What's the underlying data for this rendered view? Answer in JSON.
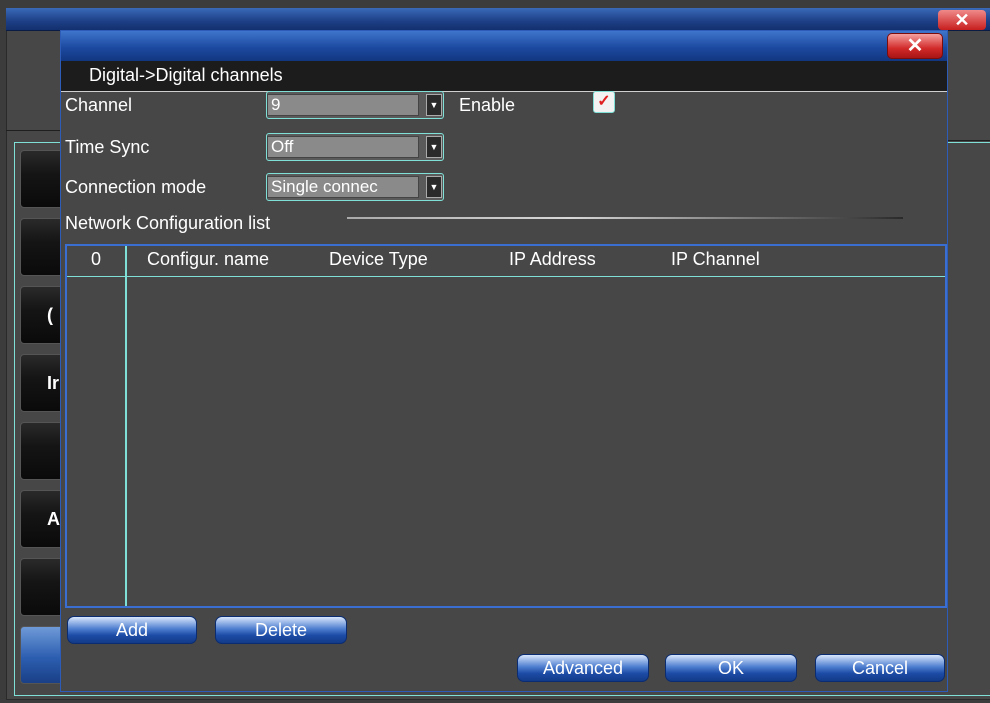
{
  "dialog": {
    "title": "Digital->Digital channels",
    "close_glyph": "✕"
  },
  "background": {
    "close_glyph": "✕",
    "tab_letters": [
      "",
      "",
      "(",
      "Ir",
      "",
      "A",
      "",
      ""
    ]
  },
  "form": {
    "channel_label": "Channel",
    "channel_value": "9",
    "enable_label": "Enable",
    "enable_checked": true,
    "check_glyph": "✓",
    "timesync_label": "Time Sync",
    "timesync_value": "Off",
    "connection_label": "Connection mode",
    "connection_value": "Single connec",
    "dropdown_arrow": "▼"
  },
  "network_list": {
    "group_label": "Network Configuration list",
    "columns": [
      "0",
      "Configur. name",
      "Device Type",
      "IP Address",
      "IP Channel"
    ],
    "rows": []
  },
  "buttons": {
    "add": "Add",
    "delete": "Delete",
    "advanced": "Advanced",
    "ok": "OK",
    "cancel": "Cancel"
  },
  "colors": {
    "accent_border": "#7fe0d8",
    "title_bar_blue": "#1c4aa0",
    "close_red": "#d22a2a",
    "panel_gray": "#474747"
  }
}
